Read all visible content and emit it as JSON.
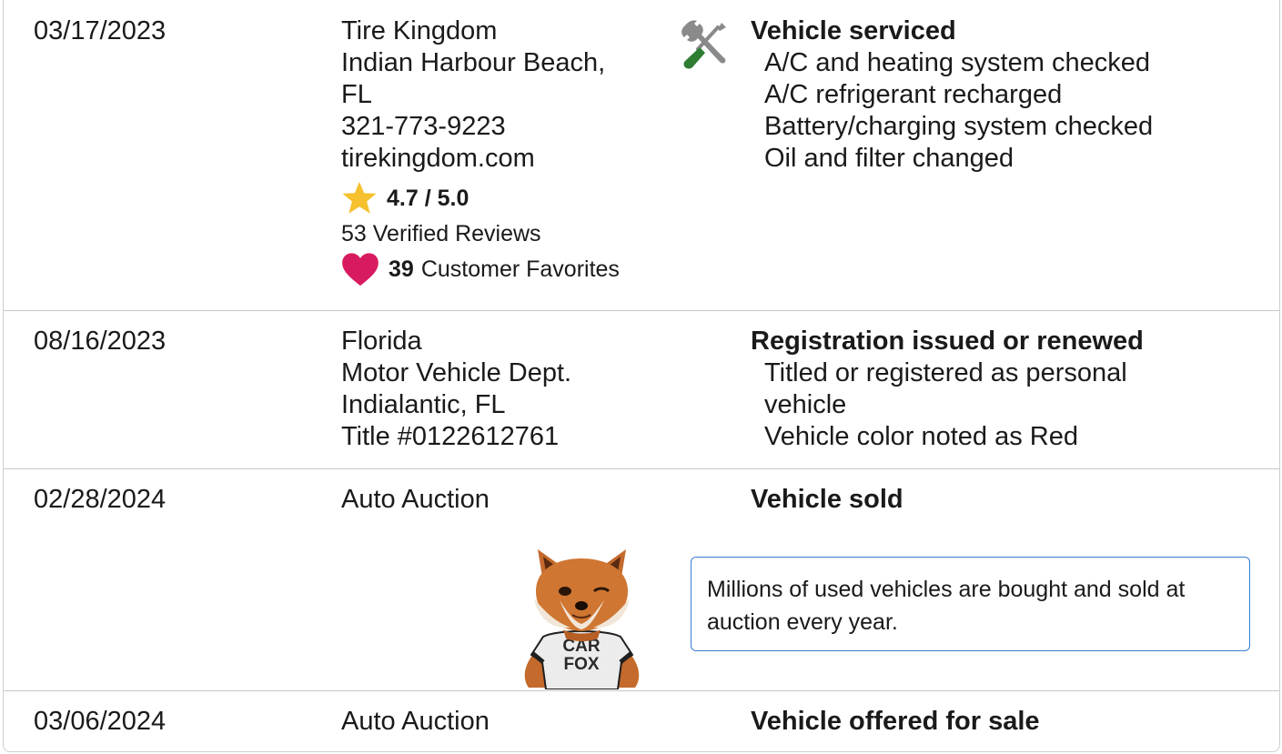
{
  "rows": [
    {
      "date": "03/17/2023",
      "location": [
        "Tire Kingdom",
        "Indian Harbour Beach,",
        "FL",
        "321-773-9223",
        "tirekingdom.com"
      ],
      "rating": "4.7 / 5.0",
      "reviews": "53 Verified Reviews",
      "favorites_count": "39",
      "favorites_label": "Customer Favorites",
      "icon": "tools-icon",
      "event": "Vehicle serviced",
      "details": [
        "A/C and heating system checked",
        "A/C refrigerant recharged",
        "Battery/charging system checked",
        "Oil and filter changed"
      ]
    },
    {
      "date": "08/16/2023",
      "location": [
        "Florida",
        "Motor Vehicle Dept.",
        "Indialantic, FL",
        "Title #0122612761"
      ],
      "event": "Registration issued or renewed",
      "details": [
        "Titled or registered as personal",
        "vehicle",
        "Vehicle color noted as Red"
      ]
    },
    {
      "date": "02/28/2024",
      "location": [
        "Auto Auction"
      ],
      "event": "Vehicle sold",
      "note": "Millions of used vehicles are bought and sold at auction every year.",
      "mascot_shirt": [
        "CAR",
        "FOX"
      ]
    },
    {
      "date": "03/06/2024",
      "location": [
        "Auto Auction"
      ],
      "event": "Vehicle offered for sale"
    }
  ],
  "colors": {
    "star": "#f6c02e",
    "heart": "#d81b60",
    "wrench": "#8a8a8a",
    "screwdriver_handle": "#2e7d32",
    "note_border": "#3a7bd5"
  }
}
